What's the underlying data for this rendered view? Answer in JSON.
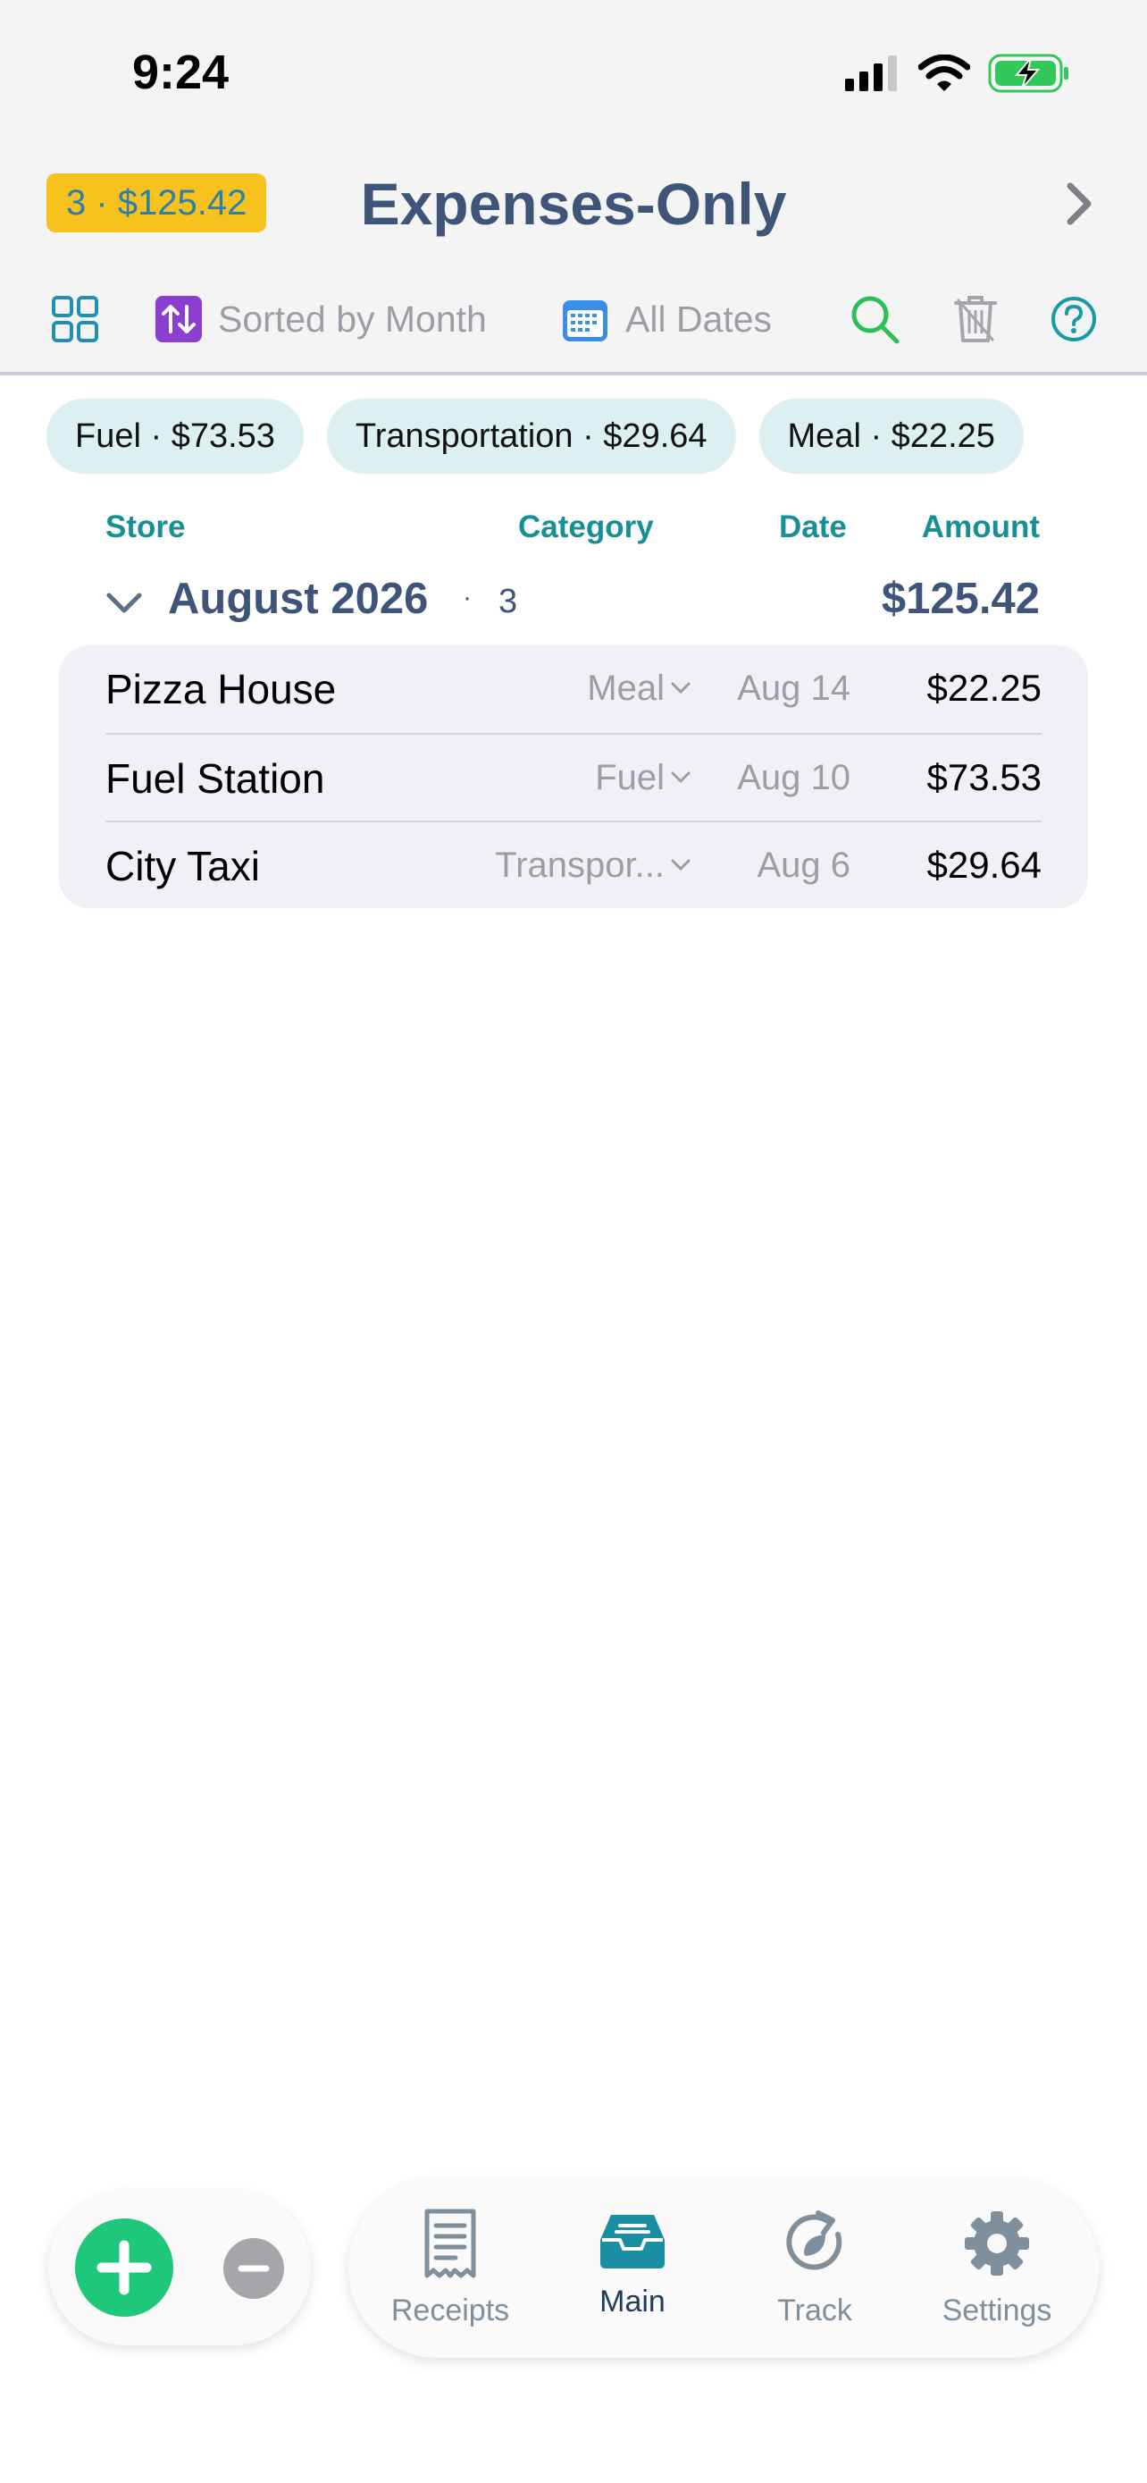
{
  "status_bar": {
    "time": "9:24"
  },
  "header": {
    "count_badge": "3 · $125.42",
    "title": "Expenses-Only"
  },
  "toolbar": {
    "sort_label": "Sorted by Month",
    "date_filter_label": "All Dates"
  },
  "category_chips": [
    {
      "label": "Fuel · $73.53"
    },
    {
      "label": "Transportation · $29.64"
    },
    {
      "label": "Meal · $22.25"
    }
  ],
  "columns": {
    "store": "Store",
    "category": "Category",
    "date": "Date",
    "amount": "Amount"
  },
  "group": {
    "title": "August 2026",
    "separator": "·",
    "count": "3",
    "total": "$125.42"
  },
  "rows": [
    {
      "store": "Pizza House",
      "category": "Meal",
      "date": "Aug 14",
      "amount": "$22.25"
    },
    {
      "store": "Fuel Station",
      "category": "Fuel",
      "date": "Aug 10",
      "amount": "$73.53"
    },
    {
      "store": "City Taxi",
      "category": "Transpor...",
      "date": "Aug 6",
      "amount": "$29.64"
    }
  ],
  "tabs": [
    {
      "label": "Receipts",
      "icon": "receipt-icon"
    },
    {
      "label": "Main",
      "icon": "inbox-tray-icon"
    },
    {
      "label": "Track",
      "icon": "track-cycle-icon"
    },
    {
      "label": "Settings",
      "icon": "gear-icon"
    }
  ],
  "colors": {
    "accent_teal": "#178f95",
    "title_navy": "#3e5478",
    "badge_yellow": "#f7c21e",
    "chip_bg": "#dcf0f2",
    "add_green": "#1fc77a"
  }
}
